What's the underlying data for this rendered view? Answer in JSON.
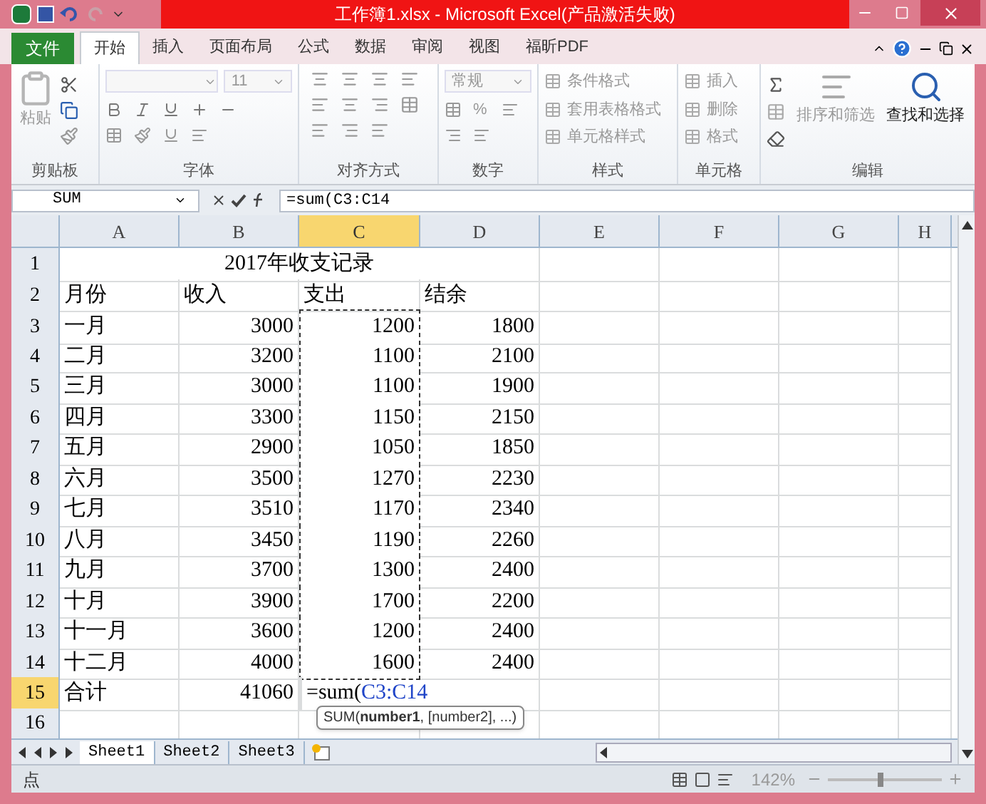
{
  "window": {
    "title": "工作簿1.xlsx - Microsoft Excel(产品激活失败)"
  },
  "ribbon_tabs": [
    {
      "label": "文件",
      "kind": "file",
      "selected": false
    },
    {
      "label": "开始",
      "kind": "tab",
      "selected": true
    },
    {
      "label": "插入",
      "kind": "tab",
      "selected": false
    },
    {
      "label": "页面布局",
      "kind": "tab",
      "selected": false
    },
    {
      "label": "公式",
      "kind": "tab",
      "selected": false
    },
    {
      "label": "数据",
      "kind": "tab",
      "selected": false
    },
    {
      "label": "审阅",
      "kind": "tab",
      "selected": false
    },
    {
      "label": "视图",
      "kind": "tab",
      "selected": false
    },
    {
      "label": "福昕PDF",
      "kind": "tab",
      "selected": false
    }
  ],
  "ribbon": {
    "paste": {
      "label": "粘贴",
      "disabled": true
    },
    "font_size": "11",
    "number_format": "常规",
    "percent": "%",
    "styles": [
      {
        "label": "条件格式",
        "disabled": true
      },
      {
        "label": "套用表格格式",
        "disabled": true
      },
      {
        "label": "单元格样式",
        "disabled": true
      }
    ],
    "cells": [
      {
        "label": "插入",
        "disabled": true
      },
      {
        "label": "删除",
        "disabled": true
      },
      {
        "label": "格式",
        "disabled": true
      }
    ],
    "sort": {
      "label": "排序和筛选",
      "disabled": true
    },
    "find": {
      "label": "查找和选择",
      "disabled": false
    },
    "group_labels": [
      "剪贴板",
      "字体",
      "对齐方式",
      "数字",
      "样式",
      "单元格",
      "编辑"
    ]
  },
  "formula_bar": {
    "name_box": "SUM",
    "formula": "=sum(C3:C14"
  },
  "columns": [
    {
      "label": "A",
      "selected": false
    },
    {
      "label": "B",
      "selected": false
    },
    {
      "label": "C",
      "selected": true
    },
    {
      "label": "D",
      "selected": false
    },
    {
      "label": "E",
      "selected": false
    },
    {
      "label": "F",
      "selected": false
    },
    {
      "label": "G",
      "selected": false
    },
    {
      "label": "H",
      "selected": false
    }
  ],
  "rows": [
    {
      "header": "1",
      "selected": false,
      "kind": "title",
      "title": "2017年收支记录"
    },
    {
      "header": "2",
      "selected": false,
      "kind": "header",
      "cells": [
        "月份",
        "收入",
        "支出",
        "结余"
      ]
    },
    {
      "header": "3",
      "selected": false,
      "kind": "data",
      "in_range": true,
      "cells": [
        "一月",
        "3000",
        "1200",
        "1800"
      ]
    },
    {
      "header": "4",
      "selected": false,
      "kind": "data",
      "in_range": true,
      "cells": [
        "二月",
        "3200",
        "1100",
        "2100"
      ]
    },
    {
      "header": "5",
      "selected": false,
      "kind": "data",
      "in_range": true,
      "cells": [
        "三月",
        "3000",
        "1100",
        "1900"
      ]
    },
    {
      "header": "6",
      "selected": false,
      "kind": "data",
      "in_range": true,
      "cells": [
        "四月",
        "3300",
        "1150",
        "2150"
      ]
    },
    {
      "header": "7",
      "selected": false,
      "kind": "data",
      "in_range": true,
      "cells": [
        "五月",
        "2900",
        "1050",
        "1850"
      ]
    },
    {
      "header": "8",
      "selected": false,
      "kind": "data",
      "in_range": true,
      "cells": [
        "六月",
        "3500",
        "1270",
        "2230"
      ]
    },
    {
      "header": "9",
      "selected": false,
      "kind": "data",
      "in_range": true,
      "cells": [
        "七月",
        "3510",
        "1170",
        "2340"
      ]
    },
    {
      "header": "10",
      "selected": false,
      "kind": "data",
      "in_range": true,
      "cells": [
        "八月",
        "3450",
        "1190",
        "2260"
      ]
    },
    {
      "header": "11",
      "selected": false,
      "kind": "data",
      "in_range": true,
      "cells": [
        "九月",
        "3700",
        "1300",
        "2400"
      ]
    },
    {
      "header": "12",
      "selected": false,
      "kind": "data",
      "in_range": true,
      "cells": [
        "十月",
        "3900",
        "1700",
        "2200"
      ]
    },
    {
      "header": "13",
      "selected": false,
      "kind": "data",
      "in_range": true,
      "cells": [
        "十一月",
        "3600",
        "1200",
        "2400"
      ]
    },
    {
      "header": "14",
      "selected": false,
      "kind": "data",
      "in_range": true,
      "cells": [
        "十二月",
        "4000",
        "1600",
        "2400"
      ]
    },
    {
      "header": "15",
      "selected": true,
      "kind": "formula",
      "label": "合计",
      "value": "41060",
      "formula": "=sum(",
      "reference": "C3:C14"
    },
    {
      "header": "16",
      "selected": false,
      "kind": "empty"
    }
  ],
  "tooltip": "SUM(**number1**, [number2], ...)",
  "sheet_tabs": [
    {
      "label": "Sheet1",
      "selected": true
    },
    {
      "label": "Sheet2",
      "selected": false
    },
    {
      "label": "Sheet3",
      "selected": false
    }
  ],
  "status_bar": {
    "mode": "点",
    "zoom": "142%",
    "zoom_level": {
      "level": 0.46
    }
  }
}
